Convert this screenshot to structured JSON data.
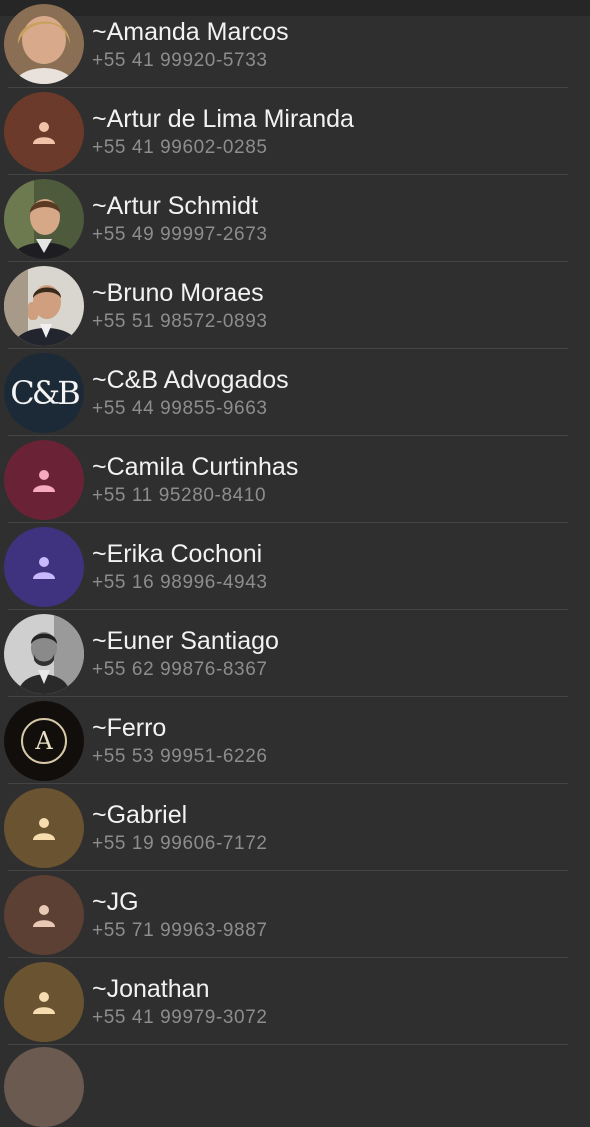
{
  "contacts": [
    {
      "name": "~Amanda Marcos",
      "phone": "+55 41 99920-5733",
      "avatar": "photo"
    },
    {
      "name": "~Artur de Lima Miranda",
      "phone": "+55 41 99602-0285",
      "avatar": "person-icon",
      "avatar_bg": "#6b3a2a",
      "icon_color": "#f3c2a8"
    },
    {
      "name": "~Artur Schmidt",
      "phone": "+55 49 99997-2673",
      "avatar": "photo"
    },
    {
      "name": "~Bruno Moraes",
      "phone": "+55 51 98572-0893",
      "avatar": "photo"
    },
    {
      "name": "~C&B Advogados",
      "phone": "+55 44 99855-9663",
      "avatar": "logo",
      "logo_text": "C&B"
    },
    {
      "name": "~Camila Curtinhas",
      "phone": "+55 11 95280-8410",
      "avatar": "person-icon",
      "avatar_bg": "#6a2236",
      "icon_color": "#f6a9bf"
    },
    {
      "name": "~Erika Cochoni",
      "phone": "+55 16 98996-4943",
      "avatar": "person-icon",
      "avatar_bg": "#3f337f",
      "icon_color": "#c8b9ff"
    },
    {
      "name": "~Euner Santiago",
      "phone": "+55 62 99876-8367",
      "avatar": "photo"
    },
    {
      "name": "~Ferro",
      "phone": "+55 53 99951-6226",
      "avatar": "logo",
      "logo_text": "A"
    },
    {
      "name": "~Gabriel",
      "phone": "+55 19 99606-7172",
      "avatar": "person-icon",
      "avatar_bg": "#6a5330",
      "icon_color": "#f6dcae"
    },
    {
      "name": "~JG",
      "phone": "+55 71 99963-9887",
      "avatar": "person-icon",
      "avatar_bg": "#5b4033",
      "icon_color": "#e8c9b5"
    },
    {
      "name": "~Jonathan",
      "phone": "+55 41 99979-3072",
      "avatar": "person-icon",
      "avatar_bg": "#6a5330",
      "icon_color": "#f6dcae"
    }
  ]
}
